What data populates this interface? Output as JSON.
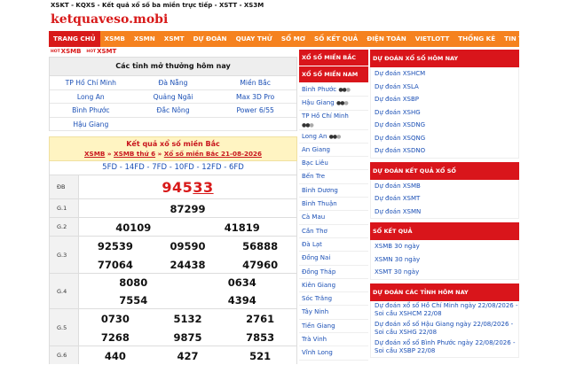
{
  "top_strip": "XSKT - KQXS - Kết quả xổ số ba miền trực tiếp - XSTT - XS3M",
  "logo": "ketquaveso.mobi",
  "nav": [
    "TRANG CHỦ",
    "XSMB",
    "XSMN",
    "XSMT",
    "DỰ ĐOÁN",
    "QUAY THỬ",
    "SỔ MƠ",
    "SỐ KẾT QUẢ",
    "ĐIỆN TOÁN",
    "VIETLOTT",
    "THỐNG KÊ",
    "TIN TỨC"
  ],
  "quick_links": [
    {
      "hot": "HOT",
      "label": "XSMB"
    },
    {
      "hot": "HOT",
      "label": "XSMT"
    }
  ],
  "open_today": {
    "title": "Các tỉnh mở thưởng hôm nay",
    "rows": [
      [
        "TP Hồ Chí Minh",
        "Đà Nẵng",
        "Miền Bắc"
      ],
      [
        "Long An",
        "Quảng Ngãi",
        "Max 3D Pro"
      ],
      [
        "Bình Phước",
        "Đắc Nông",
        "Power 6/55"
      ],
      [
        "Hậu Giang",
        "",
        ""
      ]
    ]
  },
  "result": {
    "title": "Kết quả xổ số miền Bắc",
    "crumb1": "XSMB",
    "crumb2": "XSMB thứ 6",
    "crumb3": "Xổ số miền Bắc 21-08-2026",
    "sep": "»",
    "codes": "5FD - 14FD - 7FD - 10FD - 12FD - 6FD",
    "db_label": "ĐB",
    "db_head": "945",
    "db_tail": "33",
    "prizes": [
      {
        "label": "G.1",
        "nums": [
          "87299"
        ]
      },
      {
        "label": "G.2",
        "nums": [
          "40109",
          "41819"
        ]
      },
      {
        "label": "G.3",
        "nums": [
          "92539",
          "09590",
          "56888",
          "77064",
          "24438",
          "47960"
        ]
      },
      {
        "label": "G.4",
        "nums": [
          "8080",
          "0634",
          "7554",
          "4394"
        ]
      },
      {
        "label": "G.5",
        "nums": [
          "0730",
          "5132",
          "2761",
          "7268",
          "9875",
          "7853"
        ]
      },
      {
        "label": "G.6",
        "nums": [
          "440",
          "427",
          "521"
        ]
      }
    ]
  },
  "mid": {
    "head1": "XỔ SỐ MIỀN BẮC",
    "head2": "XỔ SỐ MIỀN NAM",
    "dots": "●●",
    "items": [
      "Bình Phước",
      "Hậu Giang",
      "TP Hồ Chí Minh",
      "Long An",
      "An Giang",
      "Bạc Liêu",
      "Bến Tre",
      "Bình Dương",
      "Bình Thuận",
      "Cà Mau",
      "Cần Thơ",
      "Đà Lạt",
      "Đồng Nai",
      "Đồng Tháp",
      "Kiên Giang",
      "Sóc Trăng",
      "Tây Ninh",
      "Tiền Giang",
      "Trà Vinh",
      "Vĩnh Long"
    ]
  },
  "right": {
    "sections": [
      {
        "head": "DỰ ĐOÁN XỔ SỐ HÔM NAY",
        "items": [
          "Dự đoán XSHCM",
          "Dự đoán XSLA",
          "Dự đoán XSBP",
          "Dự đoán XSHG",
          "Dự đoán XSDNG",
          "Dự đoán XSQNG",
          "Dự đoán XSDNO"
        ]
      },
      {
        "head": "DỰ ĐOÁN KẾT QUẢ XỔ SỐ",
        "items": [
          "Dự đoán XSMB",
          "Dự đoán XSMT",
          "Dự đoán XSMN"
        ]
      },
      {
        "head": "SỔ KẾT QUẢ",
        "items": [
          "XSMB 30 ngày",
          "XSMN 30 ngày",
          "XSMT 30 ngày"
        ]
      },
      {
        "head": "DỰ ĐOÁN CÁC TỈNH HÔM NAY",
        "items": [
          "Dự đoán xổ số Hồ Chí Minh ngày 22/08/2026 - Soi cầu XSHCM 22/08",
          "Dự đoán xổ số Hậu Giang ngày 22/08/2026 - Soi cầu XSHG 22/08",
          "Dự đoán xổ số Bình Phước ngày 22/08/2026 - Soi cầu XSBP 22/08"
        ]
      }
    ]
  }
}
